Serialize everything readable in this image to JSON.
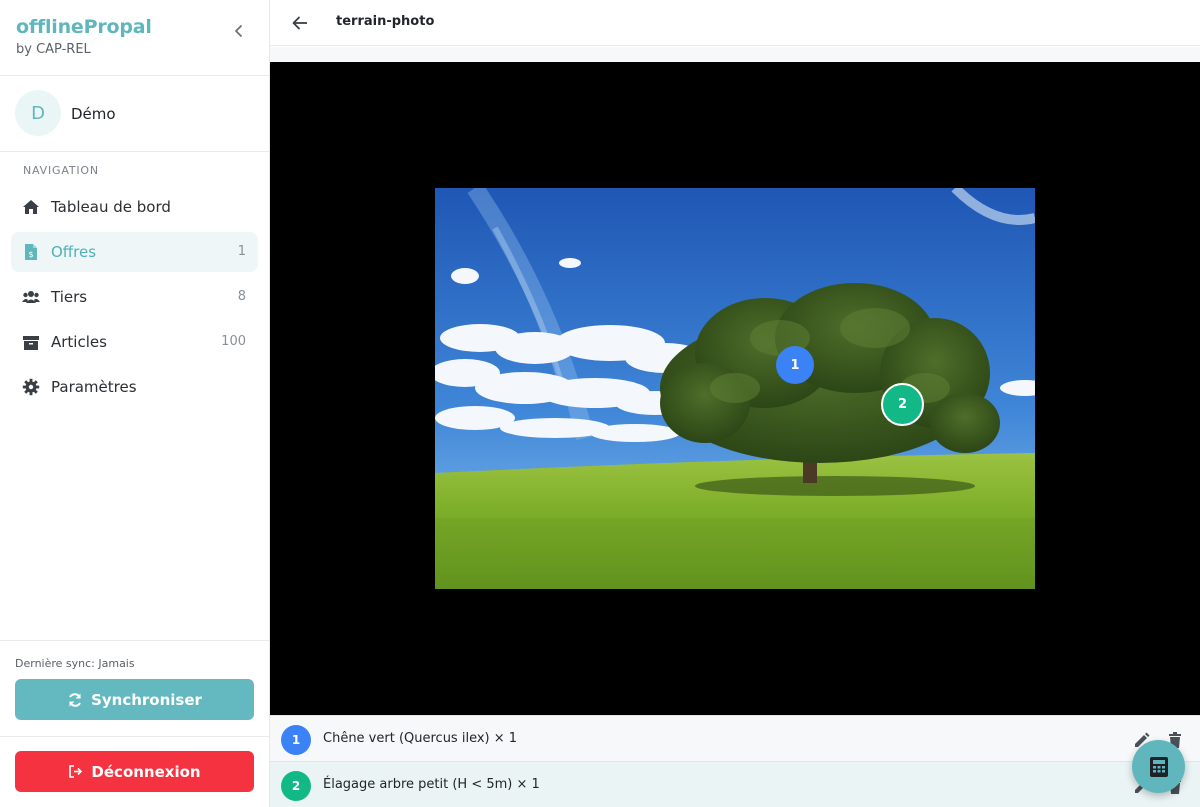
{
  "app": {
    "title": "offlinePropal",
    "subtitle": "by CAP-REL"
  },
  "user": {
    "initial": "D",
    "name": "Démo"
  },
  "nav": {
    "heading": "NAVIGATION",
    "items": [
      {
        "label": "Tableau de bord",
        "count": "",
        "icon": "home-icon",
        "active": false
      },
      {
        "label": "Offres",
        "count": "1",
        "icon": "file-invoice-icon",
        "active": true
      },
      {
        "label": "Tiers",
        "count": "8",
        "icon": "users-icon",
        "active": false
      },
      {
        "label": "Articles",
        "count": "100",
        "icon": "box-icon",
        "active": false
      },
      {
        "label": "Paramètres",
        "count": "",
        "icon": "gear-icon",
        "active": false
      }
    ]
  },
  "sync": {
    "status": "Dernière sync: Jamais",
    "button": "Synchroniser"
  },
  "logout": {
    "button": "Déconnexion"
  },
  "page": {
    "title": "terrain-photo"
  },
  "markers": [
    {
      "number": "1",
      "color": "#3b82f6"
    },
    {
      "number": "2",
      "color": "#12b886"
    }
  ],
  "items": [
    {
      "number": "1",
      "label": "Chêne vert (Quercus ilex) × 1",
      "color": "#3b82f6"
    },
    {
      "number": "2",
      "label": "Élagage arbre petit (H < 5m) × 1",
      "color": "#12b886"
    }
  ],
  "colors": {
    "accent": "#5fb7bd",
    "danger": "#f5323f",
    "marker1": "#3b82f6",
    "marker2": "#12b886"
  }
}
